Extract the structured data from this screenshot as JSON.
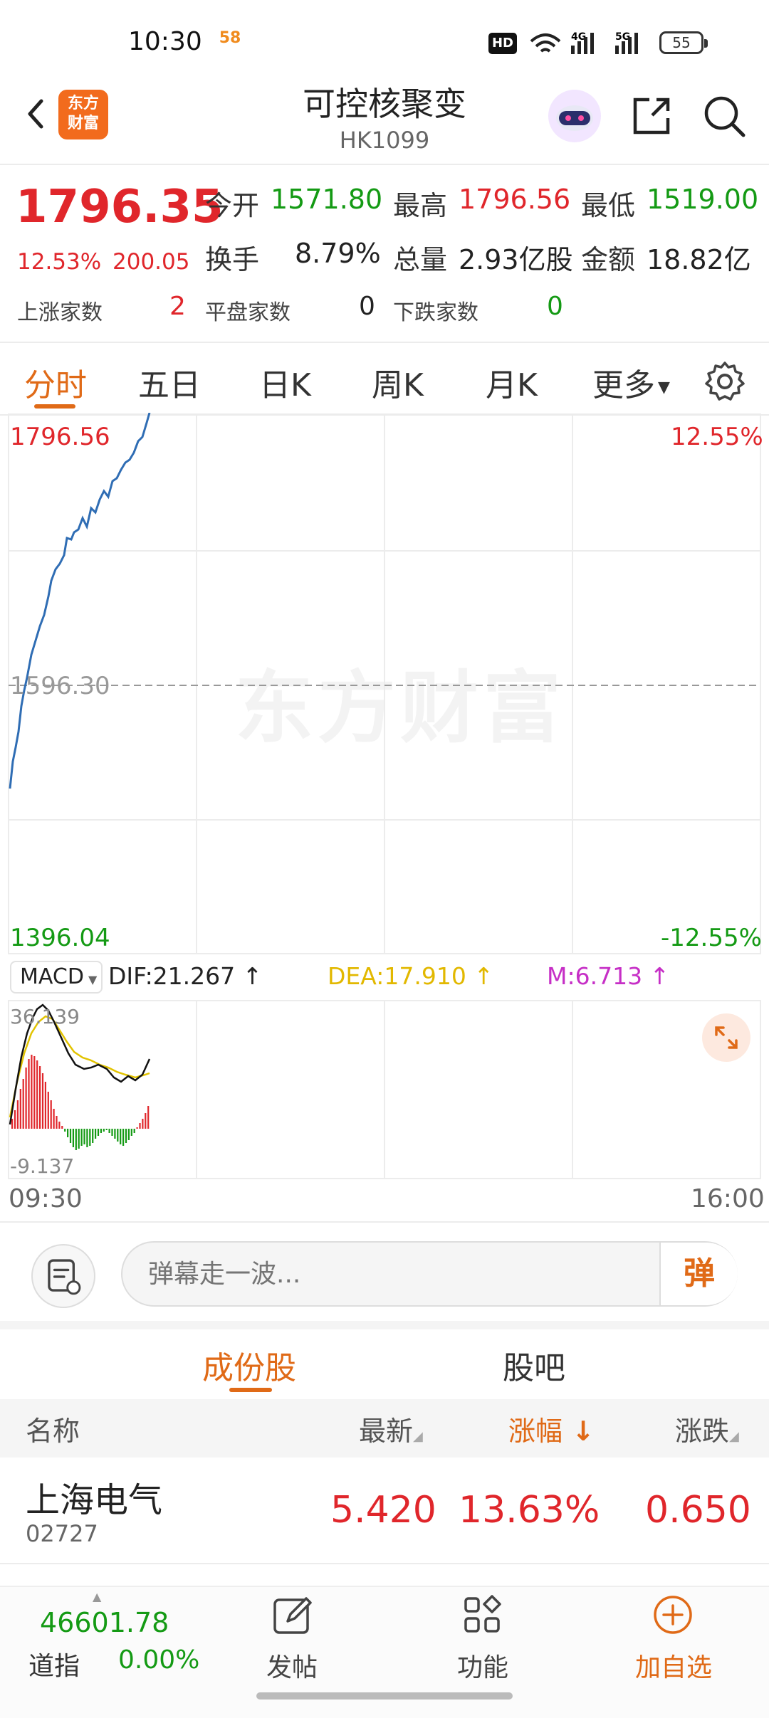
{
  "status_bar": {
    "time": "10:30",
    "badge": "58",
    "hd": "HD",
    "battery": "55",
    "network_4g": "4G",
    "network_5g": "5G"
  },
  "header": {
    "title": "可控核聚变",
    "code": "HK1099",
    "logo": "东方\n财富"
  },
  "quote": {
    "price": "1796.35",
    "change_pct": "12.53%",
    "change_amt": "200.05",
    "open_label": "今开",
    "open": "1571.80",
    "high_label": "最高",
    "high": "1796.56",
    "low_label": "最低",
    "low": "1519.00",
    "turnover_label": "换手",
    "turnover": "8.79%",
    "volume_label": "总量",
    "volume": "2.93亿股",
    "amount_label": "金额",
    "amount": "18.82亿",
    "up_label": "上涨家数",
    "up": "2",
    "flat_label": "平盘家数",
    "flat": "0",
    "down_label": "下跌家数",
    "down": "0"
  },
  "chart_tabs": [
    "分时",
    "五日",
    "日K",
    "周K",
    "月K",
    "更多"
  ],
  "chart": {
    "top_price": "1796.56",
    "top_pct": "12.55%",
    "mid_price": "1596.30",
    "bottom_price": "1396.04",
    "bottom_pct": "-12.55%",
    "watermark": "东方财富",
    "time_start": "09:30",
    "time_end": "16:00"
  },
  "macd": {
    "name": "MACD",
    "dif": "DIF:21.267",
    "dea": "DEA:17.910",
    "m": "M:6.713",
    "top": "36.139",
    "bottom": "-9.137"
  },
  "danmu": {
    "placeholder": "弹幕走一波...",
    "send": "弹"
  },
  "section_tabs": {
    "constituents": "成份股",
    "guba": "股吧"
  },
  "table": {
    "headers": {
      "name": "名称",
      "latest": "最新",
      "pct": "涨幅",
      "chg": "涨跌"
    },
    "rows": [
      {
        "name": "上海电气",
        "code": "02727",
        "latest": "5.420",
        "pct": "13.63%",
        "chg": "0.650"
      }
    ]
  },
  "bottom_bar": {
    "index_value": "46601.78",
    "index_name": "道指",
    "index_change": "0.00%",
    "post": "发帖",
    "functions": "功能",
    "add_watch": "加自选"
  },
  "colors": {
    "up": "#e0262b",
    "down": "#149a14",
    "accent": "#e06a17",
    "price_line": "#2f6db4"
  }
}
